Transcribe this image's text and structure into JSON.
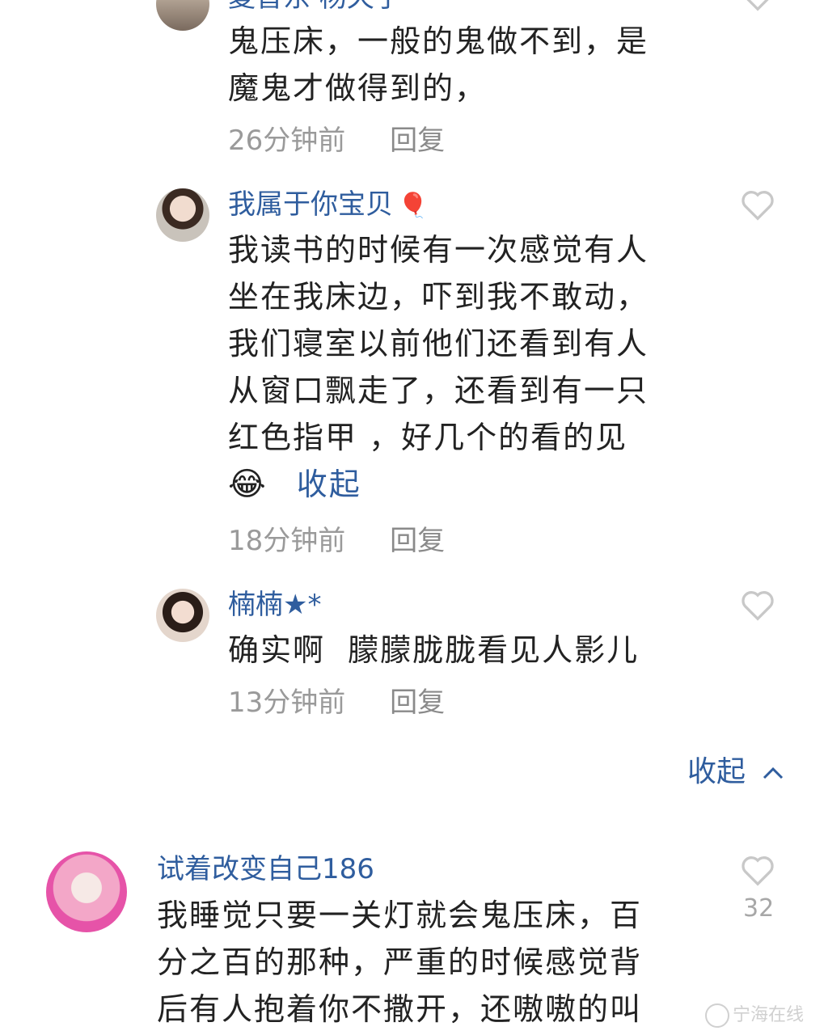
{
  "comments": [
    {
      "username": "夏普东 杨天子",
      "lines": [
        "鬼压床，一般的鬼做不到，是",
        "魔鬼才做得到的，"
      ],
      "time": "26分钟前",
      "reply_label": "回复"
    },
    {
      "username": "我属于你宝贝",
      "username_emoji": "🎈",
      "lines": [
        "我读书的时候有一次感觉有人",
        "坐在我床边，吓到我不敢动，",
        "我们寝室以前他们还看到有人",
        "从窗口飘走了，还看到有一只",
        "红色指甲 ，好几个的看的见"
      ],
      "trailing_emoji": "😂",
      "collapse_label": "收起",
      "time": "18分钟前",
      "reply_label": "回复"
    },
    {
      "username": "楠楠★*",
      "lines": [
        "确实啊  朦朦胧胧看见人影儿"
      ],
      "time": "13分钟前",
      "reply_label": "回复"
    },
    {
      "username": "试着改变自己186",
      "lines": [
        "我睡觉只要一关灯就会鬼压床，百",
        "分之百的那种，严重的时候感觉背",
        "后有人抱着你不撒开，还嗷嗷的叫"
      ],
      "like_count": "32"
    }
  ],
  "collapse_replies_label": "收起",
  "watermark": "宁海在线",
  "colors": {
    "link": "#2f5d9e",
    "meta": "#9a9a9a",
    "heart": "#c8c8c8"
  },
  "icons": {
    "heart": "heart-outline-icon",
    "chevron": "chevron-up-icon"
  }
}
